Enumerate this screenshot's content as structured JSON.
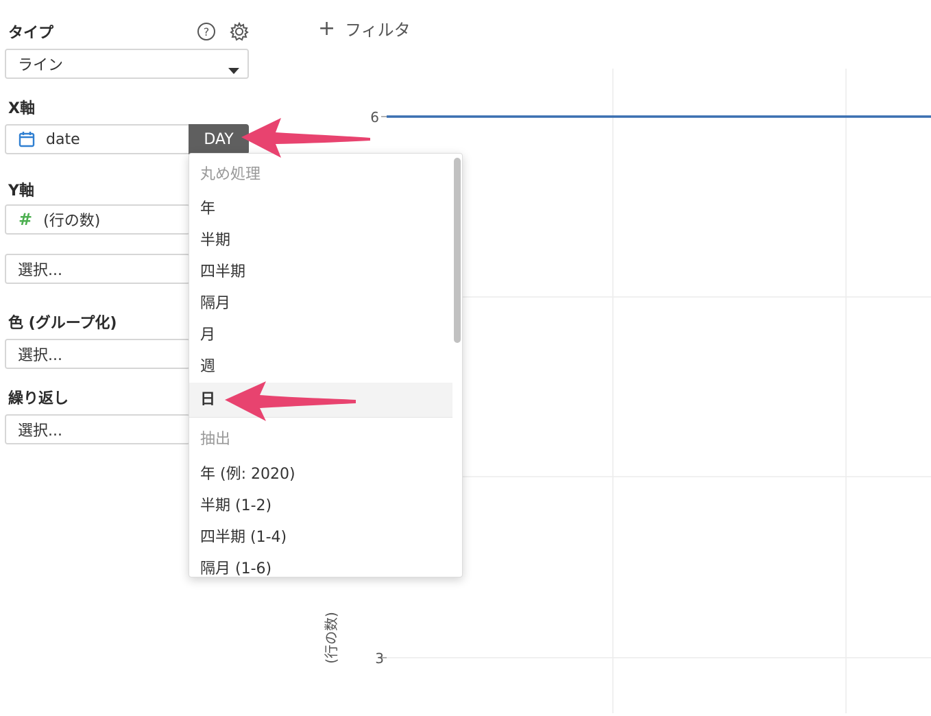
{
  "type_section": {
    "label": "タイプ",
    "selected": "ライン"
  },
  "x_axis": {
    "label": "X軸",
    "field": "date",
    "rounding_button": "DAY"
  },
  "y_axis": {
    "label": "Y軸",
    "field": "(行の数)",
    "select_placeholder": "選択..."
  },
  "color": {
    "label": "色 (グループ化)",
    "placeholder": "選択..."
  },
  "repeat": {
    "label": "繰り返し",
    "placeholder": "選択..."
  },
  "filter": {
    "label": "フィルタ"
  },
  "dropdown": {
    "rounding_header": "丸め処理",
    "rounding_items": [
      "年",
      "半期",
      "四半期",
      "隔月",
      "月",
      "週"
    ],
    "selected_item": "日",
    "extract_header": "抽出",
    "extract_items": [
      "年 (例: 2020)",
      "半期 (1-2)",
      "四半期 (1-4)",
      "隔月 (1-6)"
    ]
  },
  "chart_data": {
    "type": "line",
    "ylabel": "(行の数)",
    "y_ticks": [
      "6",
      "3"
    ],
    "series": [
      {
        "values": [
          6,
          6,
          6
        ]
      }
    ],
    "grid": true
  },
  "colors": {
    "line": "#3a6fb0",
    "arrow": "#e8436f",
    "calendar_icon": "#2f7fd1",
    "hash_icon": "#4caf50",
    "day_button": "#5f5f5f"
  }
}
